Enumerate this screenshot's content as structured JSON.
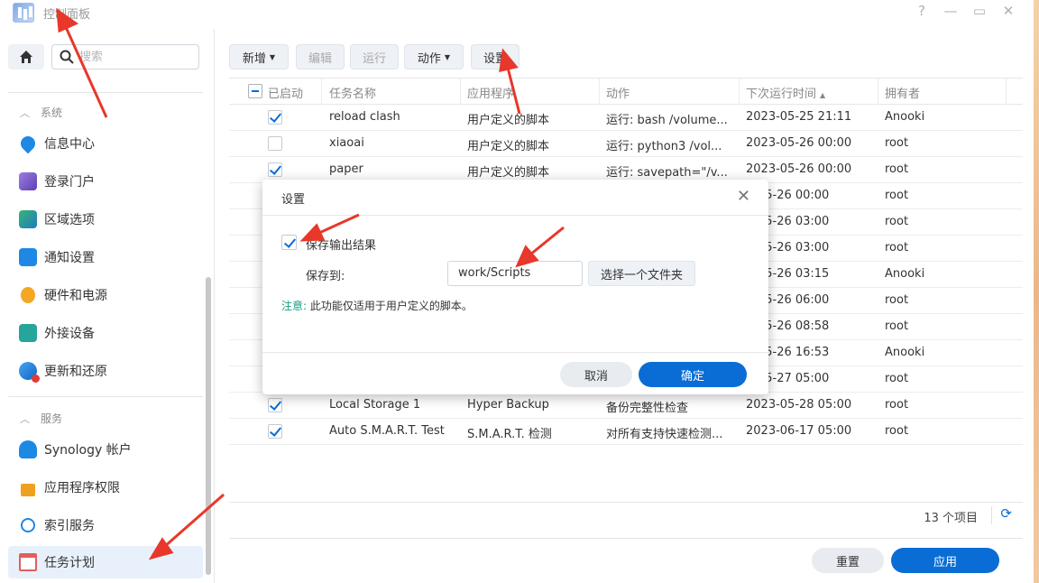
{
  "window": {
    "title": "控制面板",
    "help_glyph": "?",
    "minimize_glyph": "—",
    "maximize_glyph": "▭",
    "close_glyph": "✕"
  },
  "sidebar": {
    "search_placeholder": "搜索",
    "sections": [
      {
        "label": "系统"
      },
      {
        "label": "服务"
      }
    ],
    "items": [
      {
        "label": "信息中心",
        "icon": "info-icon",
        "color": "#1e88e5"
      },
      {
        "label": "登录门户",
        "icon": "portal-icon",
        "color": "#7b5cc4"
      },
      {
        "label": "区域选项",
        "icon": "region-icon",
        "color": "#2e9c5a"
      },
      {
        "label": "通知设置",
        "icon": "notification-icon",
        "color": "#1e88e5"
      },
      {
        "label": "硬件和电源",
        "icon": "bulb-icon",
        "color": "#f5a623"
      },
      {
        "label": "外接设备",
        "icon": "external-device-icon",
        "color": "#26a69a"
      },
      {
        "label": "更新和还原",
        "icon": "update-icon",
        "color": "#1976d2"
      },
      {
        "label": "Synology 帐户",
        "icon": "account-icon",
        "color": "#1e88e5"
      },
      {
        "label": "应用程序权限",
        "icon": "lock-icon",
        "color": "#f0a020"
      },
      {
        "label": "索引服务",
        "icon": "index-icon",
        "color": "#1e88e5"
      },
      {
        "label": "任务计划",
        "icon": "calendar-icon",
        "color": "#e35d5b"
      }
    ]
  },
  "toolbar": {
    "create": "新增",
    "edit": "编辑",
    "run": "运行",
    "action": "动作",
    "settings": "设置"
  },
  "table": {
    "headers": [
      "已启动",
      "任务名称",
      "应用程序",
      "动作",
      "下次运行时间",
      "拥有者"
    ],
    "rows": [
      {
        "enabled": true,
        "name": "reload clash",
        "app": "用户定义的脚本",
        "action": "运行: bash /volume...",
        "next": "2023-05-25 21:11",
        "owner": "Anooki"
      },
      {
        "enabled": false,
        "name": "xiaoai",
        "app": "用户定义的脚本",
        "action": "运行: python3 /vol...",
        "next": "2023-05-26 00:00",
        "owner": "root"
      },
      {
        "enabled": true,
        "name": "paper",
        "app": "用户定义的脚本",
        "action": "运行: savepath=\"/v...",
        "next": "2023-05-26 00:00",
        "owner": "root"
      },
      {
        "enabled": null,
        "name": "",
        "app": "",
        "action": "",
        "next": "3-05-26 00:00",
        "owner": "root"
      },
      {
        "enabled": null,
        "name": "",
        "app": "",
        "action": "",
        "next": "3-05-26 03:00",
        "owner": "root"
      },
      {
        "enabled": null,
        "name": "",
        "app": "",
        "action": "",
        "next": "3-05-26 03:00",
        "owner": "root"
      },
      {
        "enabled": null,
        "name": "",
        "app": "",
        "action": "",
        "next": "3-05-26 03:15",
        "owner": "Anooki"
      },
      {
        "enabled": null,
        "name": "",
        "app": "",
        "action": "",
        "next": "3-05-26 06:00",
        "owner": "root"
      },
      {
        "enabled": null,
        "name": "",
        "app": "",
        "action": "",
        "next": "3-05-26 08:58",
        "owner": "root"
      },
      {
        "enabled": null,
        "name": "",
        "app": "",
        "action": "",
        "next": "3-05-26 16:53",
        "owner": "Anooki"
      },
      {
        "enabled": null,
        "name": "",
        "app": "",
        "action": "",
        "next": "3-05-27 05:00",
        "owner": "root"
      },
      {
        "enabled": true,
        "name": "Local Storage 1",
        "app": "Hyper Backup",
        "action": "备份完整性检查",
        "next": "2023-05-28 05:00",
        "owner": "root"
      },
      {
        "enabled": true,
        "name": "Auto S.M.A.R.T. Test",
        "app": "S.M.A.R.T. 检测",
        "action": "对所有支持快速检测...",
        "next": "2023-06-17 05:00",
        "owner": "root"
      }
    ],
    "count_label": "13 个项目"
  },
  "footer": {
    "reset": "重置",
    "apply": "应用"
  },
  "dialog": {
    "title": "设置",
    "save_output_label": "保存输出结果",
    "save_output_checked": true,
    "save_to_label": "保存到:",
    "save_to_value": "work/Scripts",
    "choose_folder": "选择一个文件夹",
    "note_prefix": "注意:",
    "note_text": " 此功能仅适用于用户定义的脚本。",
    "cancel": "取消",
    "ok": "确定"
  },
  "colors": {
    "accent": "#0a6dd6",
    "annotation_arrow": "#e8372b",
    "note_highlight": "#16a085"
  }
}
